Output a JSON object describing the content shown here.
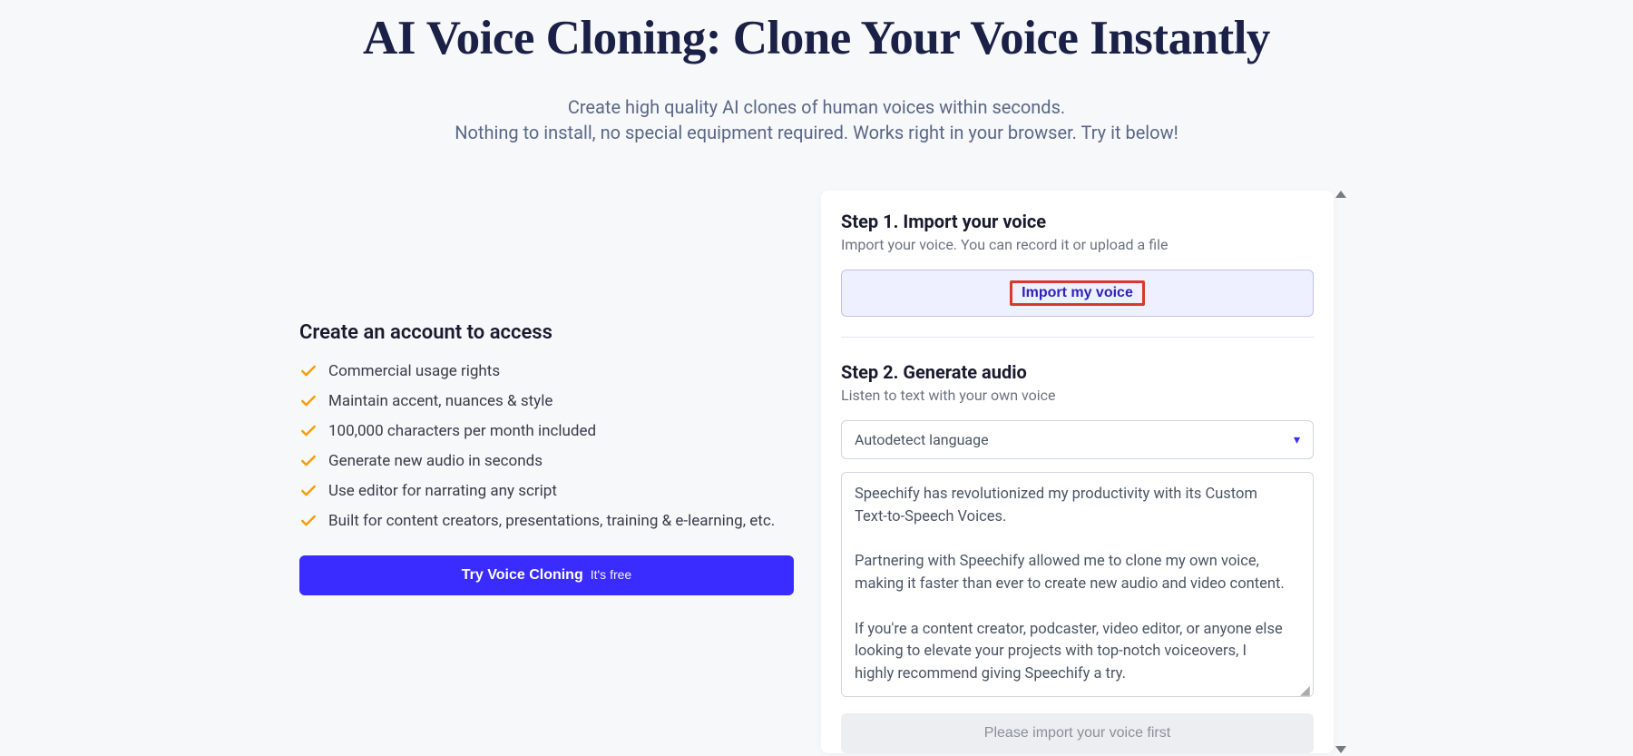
{
  "header": {
    "title": "AI Voice Cloning: Clone Your Voice Instantly",
    "subtitle_line1": "Create high quality AI clones of human voices within seconds.",
    "subtitle_line2": "Nothing to install, no special equipment required. Works right in your browser. Try it below!"
  },
  "left": {
    "heading": "Create an account to access",
    "features": [
      "Commercial usage rights",
      "Maintain accent, nuances & style",
      "100,000 characters per month included",
      "Generate new audio in seconds",
      "Use editor for narrating any script",
      "Built for content creators, presentations, training & e-learning, etc."
    ],
    "cta_bold": "Try Voice Cloning",
    "cta_light": "It's free"
  },
  "panel": {
    "step1_title": "Step 1. Import your voice",
    "step1_sub": "Import your voice. You can record it or upload a file",
    "import_btn": "Import my voice",
    "step2_title": "Step 2. Generate audio",
    "step2_sub": "Listen to text with your own voice",
    "lang_selected": "Autodetect language",
    "textarea_value": "Speechify has revolutionized my productivity with its Custom Text-to-Speech Voices.\n\nPartnering with Speechify allowed me to clone my own voice, making it faster than ever to create new audio and video content.\n\nIf you're a content creator, podcaster, video editor, or anyone else looking to elevate your projects with top-notch voiceovers, I highly recommend giving Speechify a try.",
    "disabled_btn": "Please import your voice first"
  }
}
